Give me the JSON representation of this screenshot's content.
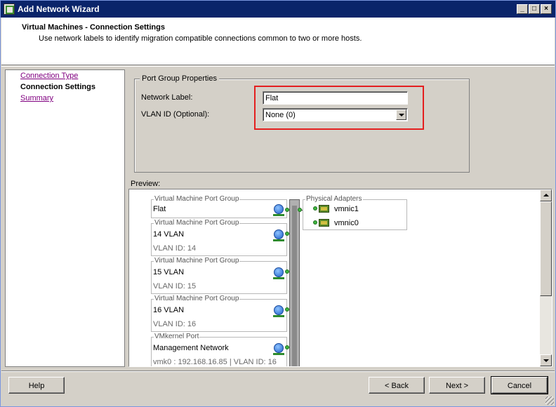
{
  "window": {
    "title": "Add Network Wizard",
    "minimize": "_",
    "maximize": "□",
    "close": "×"
  },
  "header": {
    "title": "Virtual Machines - Connection Settings",
    "subtitle": "Use network labels to identify migration compatible connections common to two or more hosts."
  },
  "nav": {
    "items": [
      {
        "label": "Connection Type",
        "state": "link"
      },
      {
        "label": "Connection Settings",
        "state": "current"
      },
      {
        "label": "Summary",
        "state": "link"
      }
    ]
  },
  "port_group_properties": {
    "legend": "Port Group Properties",
    "network_label": {
      "label": "Network Label:",
      "value": "Flat"
    },
    "vlan_id": {
      "label": "VLAN ID (Optional):",
      "value": "None (0)"
    }
  },
  "preview": {
    "label": "Preview:",
    "port_groups": [
      {
        "legend": "Virtual Machine Port Group",
        "name": "Flat",
        "vlan": ""
      },
      {
        "legend": "Virtual Machine Port Group",
        "name": "14 VLAN",
        "vlan": "VLAN ID: 14"
      },
      {
        "legend": "Virtual Machine Port Group",
        "name": "15 VLAN",
        "vlan": "VLAN ID: 15"
      },
      {
        "legend": "Virtual Machine Port Group",
        "name": "16 VLAN",
        "vlan": "VLAN ID: 16"
      },
      {
        "legend": "VMkernel Port",
        "name": "Management Network",
        "vlan": "vmk0 : 192.168.16.85 | VLAN ID: 16"
      }
    ],
    "physical_adapters": {
      "legend": "Physical Adapters",
      "nics": [
        "vmnic1",
        "vmnic0"
      ]
    }
  },
  "buttons": {
    "help": "Help",
    "back": "< Back",
    "next": "Next >",
    "cancel": "Cancel"
  },
  "colors": {
    "highlight": "#e41f1f",
    "titlebar": "#0a246a",
    "link": "#800080"
  }
}
